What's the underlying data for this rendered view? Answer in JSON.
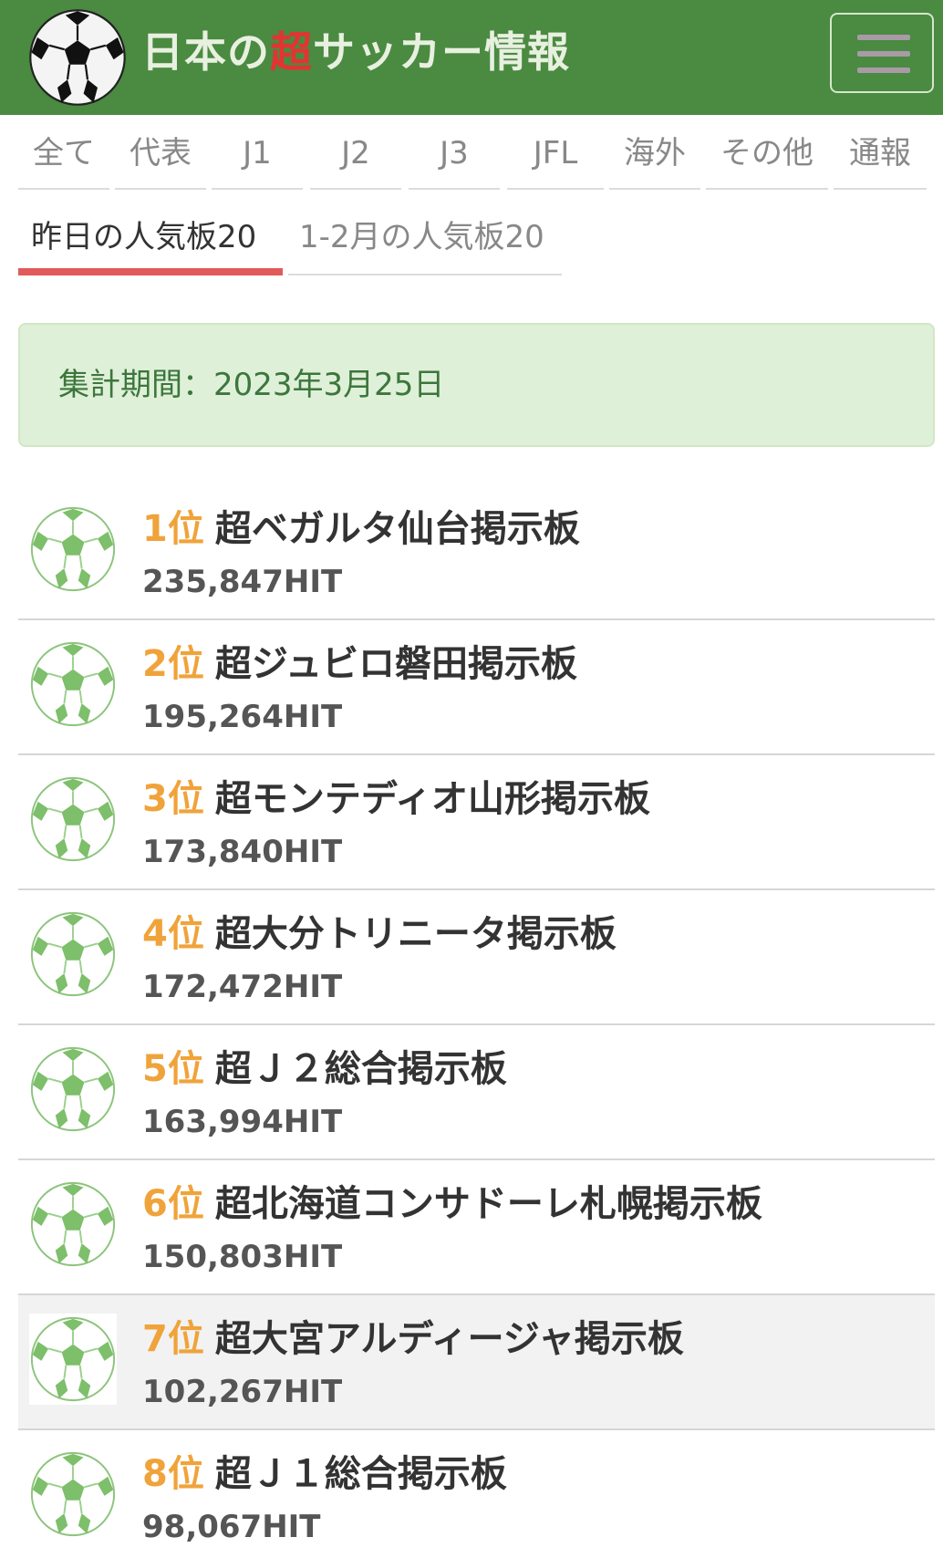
{
  "header": {
    "title_prefix": "日本の",
    "title_accent": "超",
    "title_suffix": "サッカー情報",
    "accent_color": "#e53232",
    "bg_color": "#4a8a41",
    "logo_icon": "soccer-ball-icon",
    "menu_icon": "hamburger-menu-icon"
  },
  "categories": [
    "全て",
    "代表",
    "J1",
    "J2",
    "J3",
    "JFL",
    "海外",
    "その他",
    "通報"
  ],
  "ranking_tabs": {
    "active": "昨日の人気板20",
    "inactive": "1-2月の人気板20"
  },
  "period": {
    "text": "集計期間：2023年3月25日"
  },
  "rankings": [
    {
      "rank": "1位",
      "name": "超ベガルタ仙台掲示板",
      "hits": "235,847HIT"
    },
    {
      "rank": "2位",
      "name": "超ジュビロ磐田掲示板",
      "hits": "195,264HIT"
    },
    {
      "rank": "3位",
      "name": "超モンテディオ山形掲示板",
      "hits": "173,840HIT"
    },
    {
      "rank": "4位",
      "name": "超大分トリニータ掲示板",
      "hits": "172,472HIT"
    },
    {
      "rank": "5位",
      "name": "超Ｊ２総合掲示板",
      "hits": "163,994HIT"
    },
    {
      "rank": "6位",
      "name": "超北海道コンサドーレ札幌掲示板",
      "hits": "150,803HIT"
    },
    {
      "rank": "7位",
      "name": "超大宮アルディージャ掲示板",
      "hits": "102,267HIT"
    },
    {
      "rank": "8位",
      "name": "超Ｊ１総合掲示板",
      "hits": "98,067HIT"
    }
  ],
  "colors": {
    "rank": "#f0a33a",
    "active_tab_underline": "#e25a5a",
    "period_bg": "#dff0d8",
    "period_text": "#3c763d",
    "ball_green": "#7dbf6a"
  }
}
